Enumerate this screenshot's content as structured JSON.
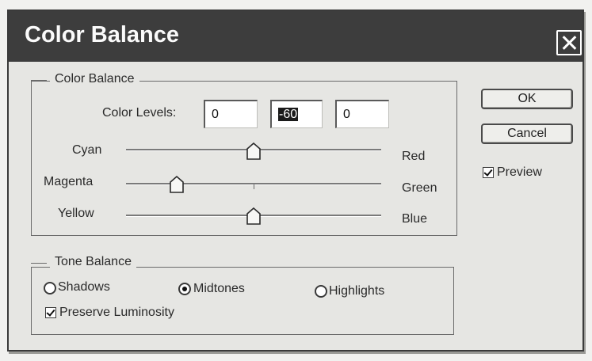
{
  "window": {
    "title": "Color Balance",
    "close_icon": "close-icon"
  },
  "color_balance_group": {
    "legend": "Color Balance",
    "levels_label": "Color Levels:",
    "levels": [
      "0",
      "-60",
      "0"
    ],
    "sliders": [
      {
        "left_label": "Cyan",
        "right_label": "Red",
        "value": 0
      },
      {
        "left_label": "Magenta",
        "right_label": "Green",
        "value": -60
      },
      {
        "left_label": "Yellow",
        "right_label": "Blue",
        "value": 0
      }
    ]
  },
  "tone_balance_group": {
    "legend": "Tone Balance",
    "options": [
      {
        "label": "Shadows",
        "selected": false
      },
      {
        "label": "Midtones",
        "selected": true
      },
      {
        "label": "Highlights",
        "selected": false
      }
    ],
    "preserve_luminosity": {
      "label": "Preserve Luminosity",
      "checked": true
    }
  },
  "buttons": {
    "ok": "OK",
    "cancel": "Cancel"
  },
  "preview": {
    "label": "Preview",
    "checked": true
  }
}
